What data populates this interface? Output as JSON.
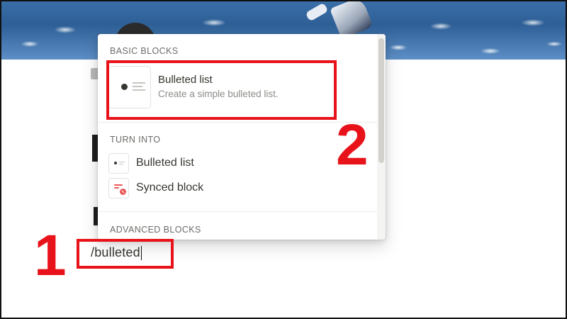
{
  "editor": {
    "command_text": "/bulleted"
  },
  "menu": {
    "sections": {
      "basic_blocks": "BASIC BLOCKS",
      "turn_into": "TURN INTO",
      "advanced_blocks": "ADVANCED BLOCKS"
    },
    "highlighted_item": {
      "title": "Bulleted list",
      "description": "Create a simple bulleted list.",
      "icon": "bulleted-list-icon"
    },
    "turn_into_items": [
      {
        "label": "Bulleted list",
        "icon": "bulleted-list-icon"
      },
      {
        "label": "Synced block",
        "icon": "synced-block-icon"
      }
    ]
  },
  "annotations": {
    "step_1": "1",
    "step_2": "2",
    "color": "#e8131a"
  }
}
